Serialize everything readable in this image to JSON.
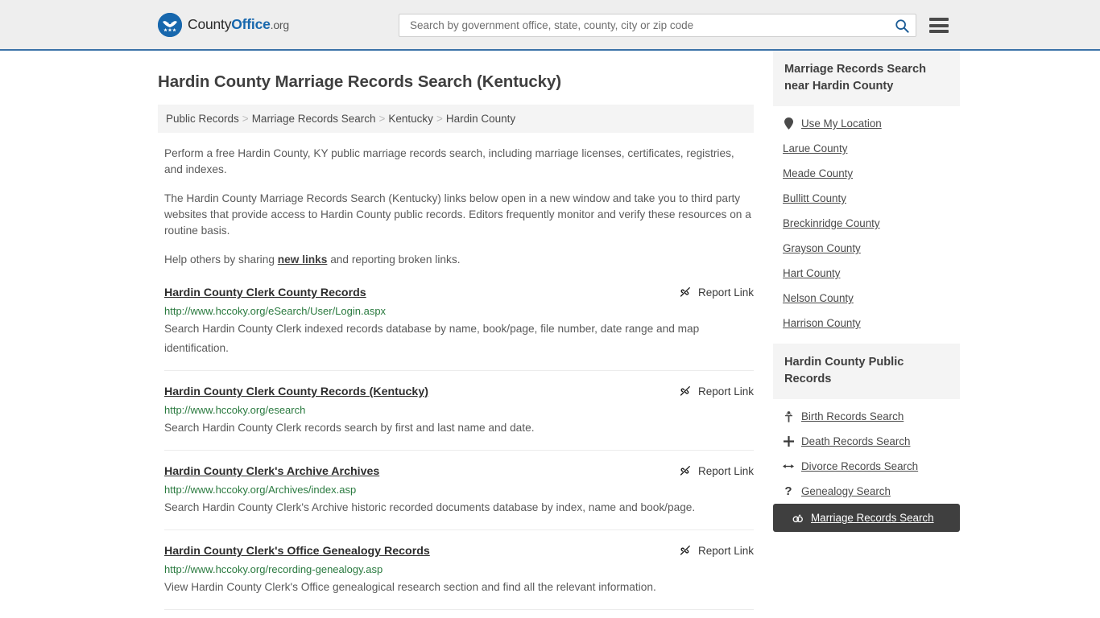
{
  "header": {
    "logo_text_a": "County",
    "logo_text_b": "Office",
    "logo_text_c": ".org",
    "logo_icon": "eagle-stars-shield-icon",
    "search_placeholder": "Search by government office, state, county, city or zip code",
    "search_value": "",
    "search_icon": "search-icon",
    "menu_icon": "hamburger-menu-icon",
    "accent_color": "#1767ad",
    "border_color": "#3b72a8"
  },
  "main": {
    "page_title": "Hardin County Marriage Records Search (Kentucky)",
    "breadcrumb": [
      "Public Records",
      "Marriage Records Search",
      "Kentucky",
      "Hardin County"
    ],
    "breadcrumb_separator": ">",
    "intro": {
      "p1": "Perform a free Hardin County, KY public marriage records search, including marriage licenses, certificates, registries, and indexes.",
      "p2": "The Hardin County Marriage Records Search (Kentucky) links below open in a new window and take you to third party websites that provide access to Hardin County public records. Editors frequently monitor and verify these resources on a routine basis.",
      "p3_before": "Help others by sharing ",
      "p3_link": "new links",
      "p3_after": " and reporting broken links."
    },
    "report_link_label": "Report Link",
    "report_link_icon": "broken-link-icon",
    "results": [
      {
        "title": "Hardin County Clerk County Records",
        "url": "http://www.hccoky.org/eSearch/User/Login.aspx",
        "description": "Search Hardin County Clerk indexed records database by name, book/page, file number, date range and map identification."
      },
      {
        "title": "Hardin County Clerk County Records (Kentucky)",
        "url": "http://www.hccoky.org/esearch",
        "description": "Search Hardin County Clerk records search by first and last name and date."
      },
      {
        "title": "Hardin County Clerk's Archive Archives",
        "url": "http://www.hccoky.org/Archives/index.asp",
        "description": "Search Hardin County Clerk's Archive historic recorded documents database by index, name and book/page."
      },
      {
        "title": "Hardin County Clerk's Office Genealogy Records",
        "url": "http://www.hccoky.org/recording-genealogy.asp",
        "description": "View Hardin County Clerk's Office genealogical research section and find all the relevant information."
      }
    ]
  },
  "sidebar": {
    "nearby": {
      "heading": "Marriage Records Search near Hardin County",
      "items": [
        {
          "label": "Use My Location",
          "icon": "map-pin-icon"
        },
        {
          "label": "Larue County",
          "icon": ""
        },
        {
          "label": "Meade County",
          "icon": ""
        },
        {
          "label": "Bullitt County",
          "icon": ""
        },
        {
          "label": "Breckinridge County",
          "icon": ""
        },
        {
          "label": "Grayson County",
          "icon": ""
        },
        {
          "label": "Hart County",
          "icon": ""
        },
        {
          "label": "Nelson County",
          "icon": ""
        },
        {
          "label": "Harrison County",
          "icon": ""
        }
      ]
    },
    "public_records": {
      "heading": "Hardin County Public Records",
      "items": [
        {
          "label": "Birth Records Search",
          "icon": "baby-icon",
          "glyph": "👶",
          "active": false
        },
        {
          "label": "Death Records Search",
          "icon": "cross-icon",
          "glyph": "✚",
          "active": false
        },
        {
          "label": "Divorce Records Search",
          "icon": "split-arrows-icon",
          "glyph": "↔",
          "active": false
        },
        {
          "label": "Genealogy Search",
          "icon": "question-mark-icon",
          "glyph": "?",
          "active": false
        },
        {
          "label": "Marriage Records Search",
          "icon": "wedding-rings-icon",
          "glyph": "⚭",
          "active": true
        }
      ]
    }
  }
}
